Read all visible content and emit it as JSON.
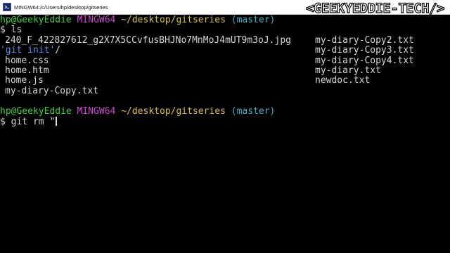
{
  "window": {
    "title": "MINGW64:/c/Users/hp/desktop/gitseries",
    "icon": "mingw-terminal-icon"
  },
  "watermark": {
    "text": "<GEEKYEDDIE-TECH/>"
  },
  "terminal": {
    "prompt1": {
      "user_host": "hp@GeekyEddie",
      "system": "MINGW64",
      "path": "~/desktop/gitseries",
      "branch": "(master)"
    },
    "command1": "$ ls",
    "ls_output_left": [
      "240_F_422827612_g2X7X5CCvfusBHJNo7MnMoJ4mUT9m3oJ.jpg",
      "home.css",
      "home.htm",
      "home.js",
      "my-diary-Copy.txt"
    ],
    "ls_dir_entry": {
      "name": "'git init'",
      "suffix": "/"
    },
    "ls_output_right": [
      "my-diary-Copy2.txt",
      "my-diary-Copy3.txt",
      "my-diary-Copy4.txt",
      "my-diary.txt",
      "newdoc.txt"
    ],
    "prompt2": {
      "user_host": "hp@GeekyEddie",
      "system": "MINGW64",
      "path": "~/desktop/gitseries",
      "branch": "(master)"
    },
    "command2": "$ git rm \""
  },
  "colors": {
    "background": "#000000",
    "prompt_user": "#3fcf3f",
    "prompt_system": "#c848c8",
    "prompt_path": "#d6c13b",
    "prompt_branch": "#3fb3c4",
    "directory": "#5b8fe8",
    "text": "#c9c9c9"
  }
}
